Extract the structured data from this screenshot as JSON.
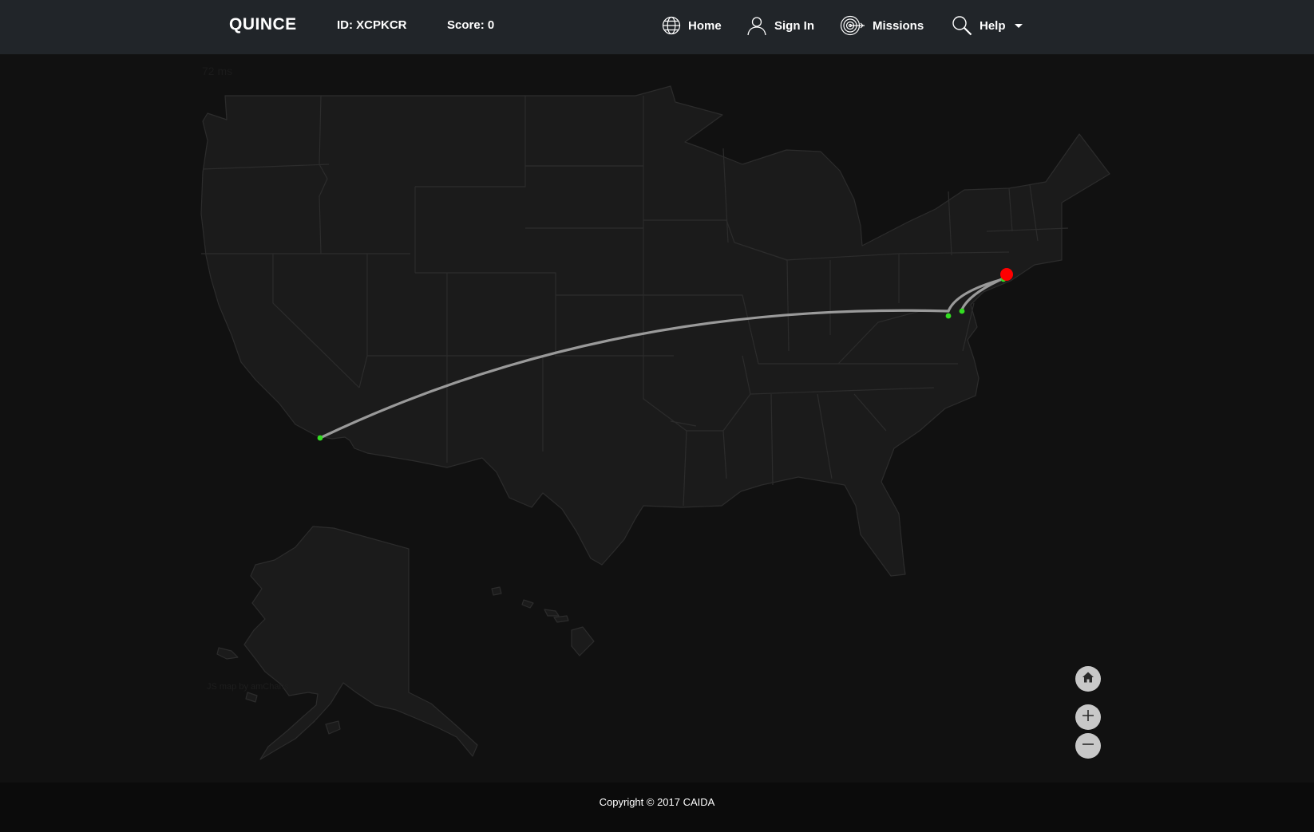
{
  "header": {
    "brand": "QUINCE",
    "id_label": "ID: XCPKCR",
    "score_label": "Score: 0",
    "nav": {
      "home": "Home",
      "sign_in": "Sign In",
      "missions": "Missions",
      "help": "Help"
    }
  },
  "map": {
    "latency": "72 ms",
    "credit": "JS map by amCharts",
    "background_color": "#111111",
    "state_fill_color": "#1b1b1b",
    "state_border_color": "#2c2c2c",
    "route_color": "#9a9a9a",
    "hop_color": "#33dd22",
    "target_color": "#ff0000",
    "controls": {
      "home_icon": "home-icon",
      "zoom_in_icon": "plus-icon",
      "zoom_out_icon": "minus-icon"
    }
  },
  "footer": {
    "copyright": "Copyright © 2017 CAIDA"
  }
}
